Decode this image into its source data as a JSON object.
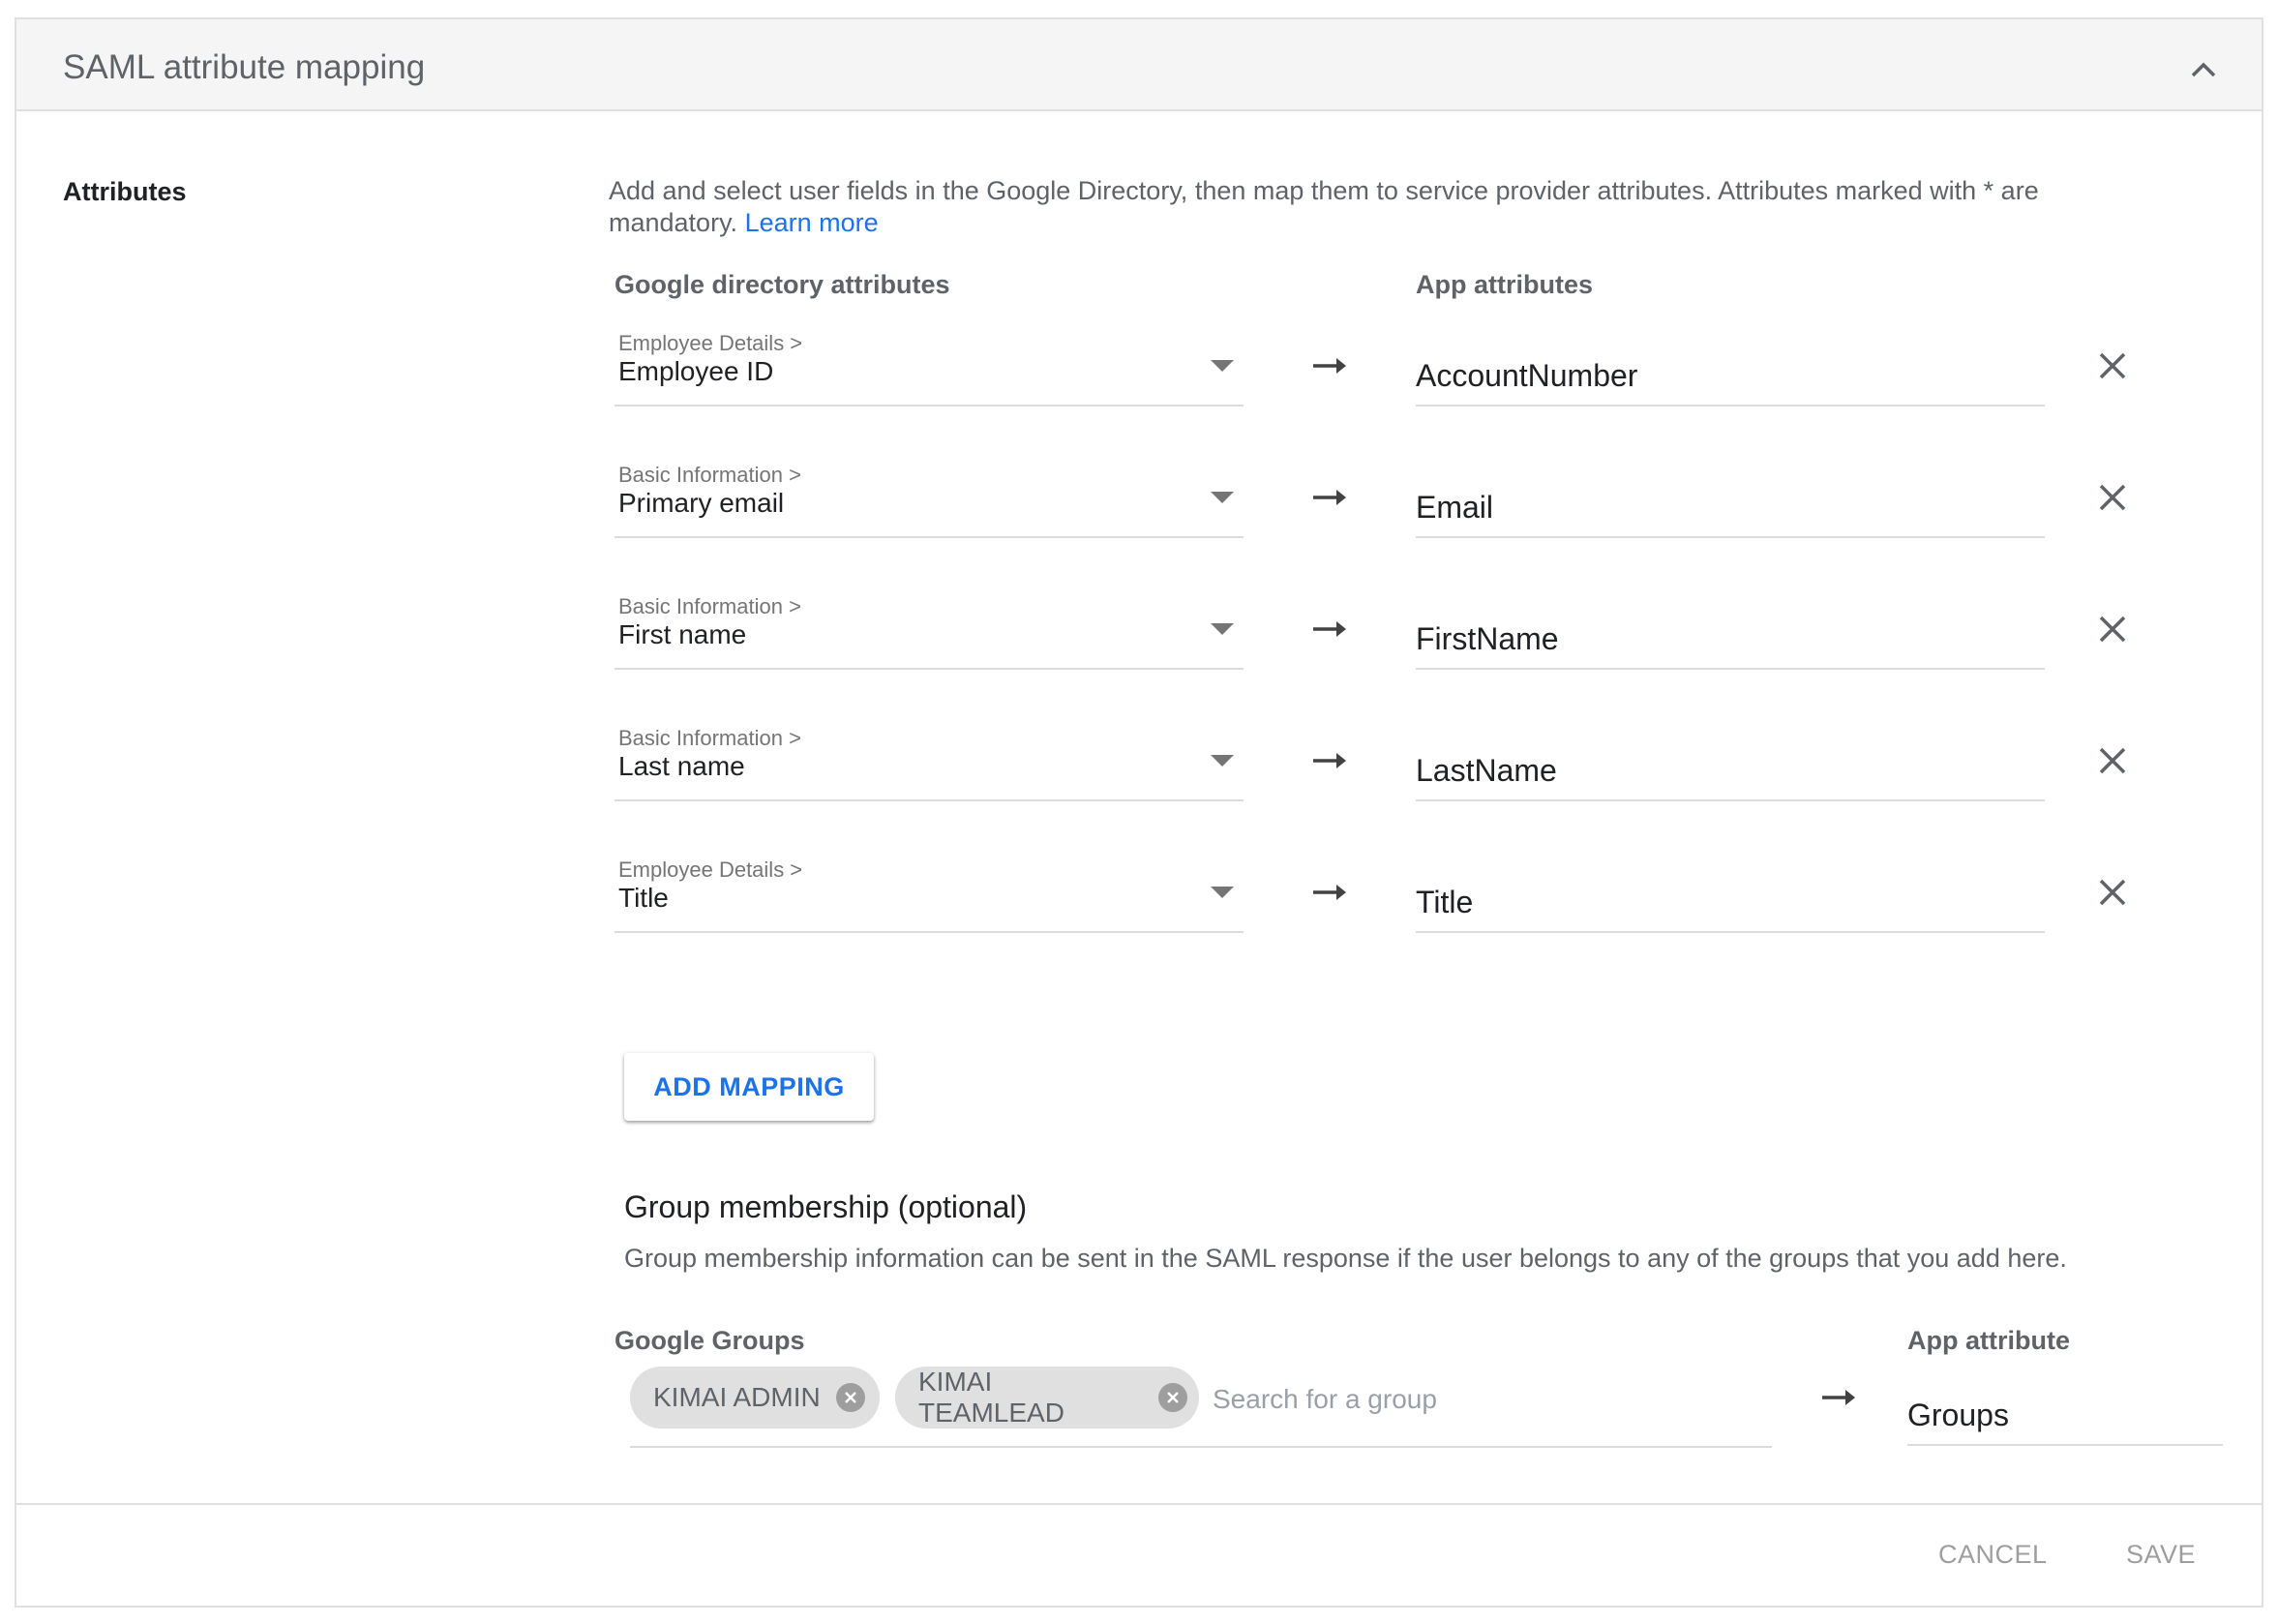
{
  "panel": {
    "title": "SAML attribute mapping",
    "collapse_icon": "chevron-up-icon"
  },
  "attributes": {
    "label": "Attributes",
    "description": "Add and select user fields in the Google Directory, then map them to service provider attributes. Attributes marked with * are mandatory.",
    "learn_more": "Learn more",
    "col_directory": "Google directory attributes",
    "col_app": "App attributes",
    "mappings": [
      {
        "category": "Employee Details >",
        "field": "Employee ID",
        "app_attribute": "AccountNumber"
      },
      {
        "category": "Basic Information >",
        "field": "Primary email",
        "app_attribute": "Email"
      },
      {
        "category": "Basic Information >",
        "field": "First name",
        "app_attribute": "FirstName"
      },
      {
        "category": "Basic Information >",
        "field": "Last name",
        "app_attribute": "LastName"
      },
      {
        "category": "Employee Details >",
        "field": "Title",
        "app_attribute": "Title"
      }
    ],
    "add_mapping_label": "ADD MAPPING"
  },
  "group_membership": {
    "heading": "Group membership (optional)",
    "description": "Group membership information can be sent in the SAML response if the user belongs to any of the groups that you add here.",
    "col_groups": "Google Groups",
    "col_app": "App attribute",
    "chips": [
      "KIMAI ADMIN",
      "KIMAI TEAMLEAD"
    ],
    "search_placeholder": "Search for a group",
    "app_attribute": "Groups"
  },
  "footer": {
    "cancel_label": "CANCEL",
    "save_label": "SAVE"
  },
  "colors": {
    "accent": "#1a73e8",
    "header_bg": "#f5f5f5",
    "chip_bg": "#e0e0e0",
    "disabled_text": "#9e9e9e"
  }
}
